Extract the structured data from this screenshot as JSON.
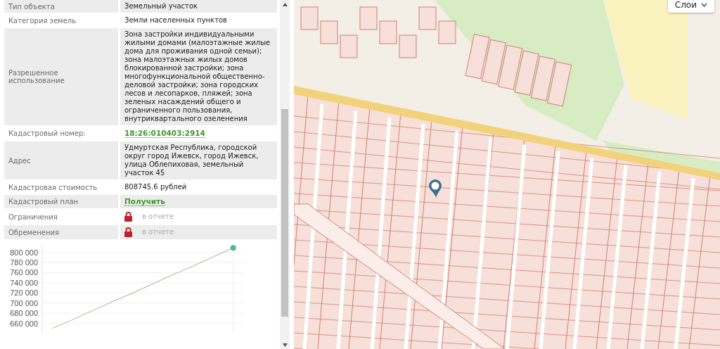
{
  "properties": [
    {
      "label": "Тип объекта",
      "kind": "text",
      "value": "Земельный участок"
    },
    {
      "label": "Категория земель",
      "kind": "text",
      "value": "Земли населенных пунктов"
    },
    {
      "label": "Разрешенное использование",
      "kind": "text",
      "value": "Зона застройки индивидуальными жилыми домами (малоэтажные жилые дома для проживания одной семьи); зона малоэтажных жилых домов блокированной застройки; зона многофункциональной общественно-деловой застройки; зона городских лесов и лесопарков, пляжей; зона зеленых насаждений общего и ограниченного пользования, внутриквартального озеленения"
    },
    {
      "label": "Кадастровый номер:",
      "kind": "link",
      "value": "18:26:010403:2914"
    },
    {
      "label": "Адрес",
      "kind": "text",
      "value": "Удмуртская Республика, городской округ город Ижевск, город Ижевск, улица Облепиховая, земельный участок 45"
    },
    {
      "label": "Кадастровая стоимость",
      "kind": "text",
      "value": "808745.6 рублей"
    },
    {
      "label": "Кадастровый план",
      "kind": "link",
      "value": "Получить"
    },
    {
      "label": "Ограничения",
      "kind": "locked",
      "value": "в отчете"
    },
    {
      "label": "Обременения",
      "kind": "locked",
      "value": "в отчете"
    }
  ],
  "chart_data": {
    "type": "line",
    "yticks": [
      {
        "value": 660000,
        "label": "660 000"
      },
      {
        "value": 680000,
        "label": "680 000"
      },
      {
        "value": 700000,
        "label": "700 000"
      },
      {
        "value": 720000,
        "label": "720 000"
      },
      {
        "value": 740000,
        "label": "740 000"
      },
      {
        "value": 760000,
        "label": "760 000"
      },
      {
        "value": 780000,
        "label": "780 000"
      },
      {
        "value": 800000,
        "label": "800 000"
      }
    ],
    "categories": [
      null,
      null,
      null,
      null,
      null,
      null,
      null,
      null,
      null,
      null
    ],
    "ylim": [
      640000,
      812000
    ],
    "grid": true,
    "series": [
      {
        "color": "#c8c0b0",
        "values": [
          650000,
          667000,
          685000,
          703000,
          720000,
          738000,
          756000,
          773000,
          791000,
          809000
        ]
      }
    ]
  },
  "map": {
    "layers_button": "Слои"
  }
}
